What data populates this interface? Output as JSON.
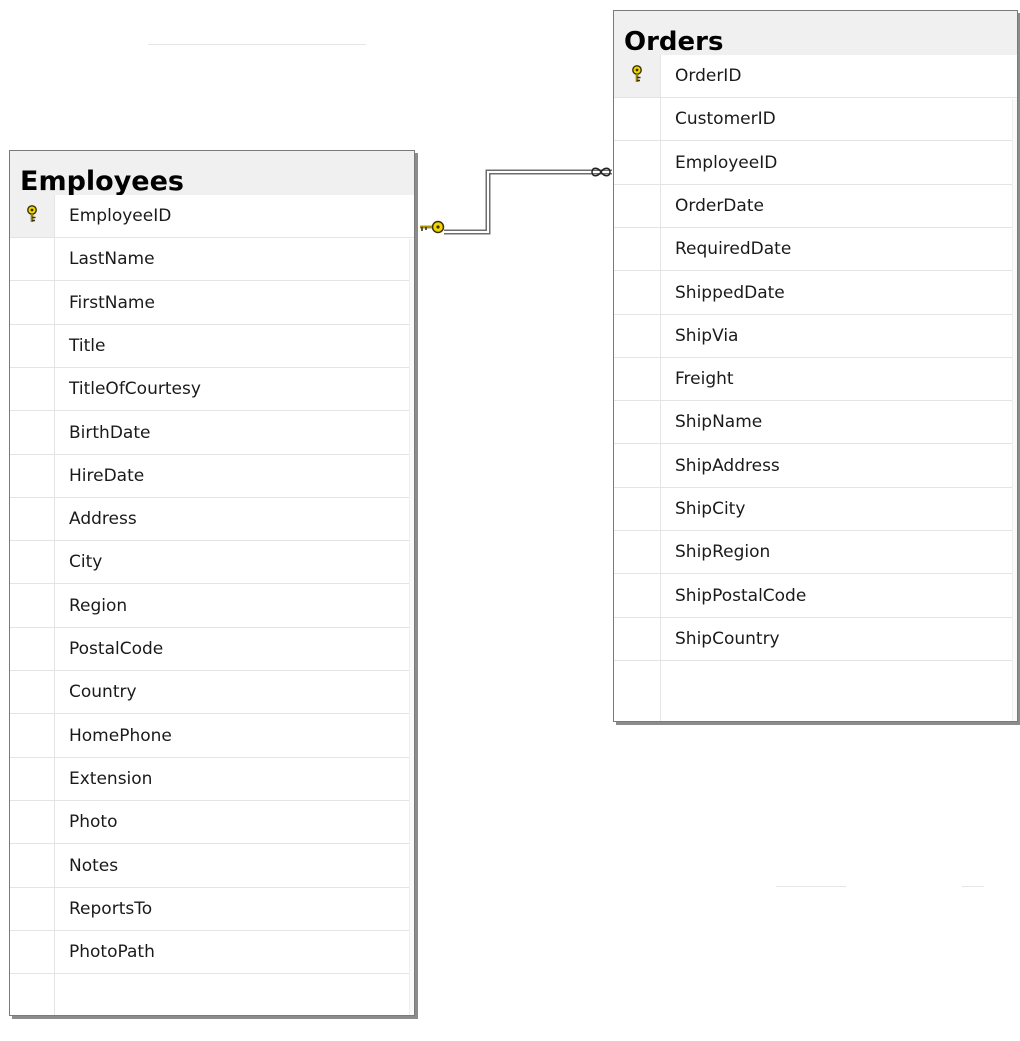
{
  "tables": {
    "employees": {
      "title": "Employees",
      "primary_key": "EmployeeID",
      "columns": [
        "EmployeeID",
        "LastName",
        "FirstName",
        "Title",
        "TitleOfCourtesy",
        "BirthDate",
        "HireDate",
        "Address",
        "City",
        "Region",
        "PostalCode",
        "Country",
        "HomePhone",
        "Extension",
        "Photo",
        "Notes",
        "ReportsTo",
        "PhotoPath"
      ]
    },
    "orders": {
      "title": "Orders",
      "primary_key": "OrderID",
      "columns": [
        "OrderID",
        "CustomerID",
        "EmployeeID",
        "OrderDate",
        "RequiredDate",
        "ShippedDate",
        "ShipVia",
        "Freight",
        "ShipName",
        "ShipAddress",
        "ShipCity",
        "ShipRegion",
        "ShipPostalCode",
        "ShipCountry"
      ]
    }
  },
  "relationship": {
    "from_table": "Employees",
    "to_table": "Orders",
    "from_cardinality": "one",
    "to_cardinality": "many",
    "from_icon": "key-icon",
    "to_icon": "infinity-icon"
  },
  "colors": {
    "key_fill": "#f2d600",
    "key_stroke": "#3a3000",
    "connector": "#8a8a8a",
    "row_divider": "#e4e4e4",
    "title_bg": "#f0f0f0"
  }
}
